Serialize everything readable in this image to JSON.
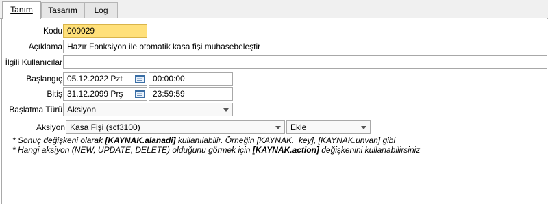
{
  "tabs": [
    {
      "label": "Tanım"
    },
    {
      "label": "Tasarım"
    },
    {
      "label": "Log"
    }
  ],
  "form": {
    "kodu_label": "Kodu",
    "kodu_value": "000029",
    "aciklama_label": "Açıklama",
    "aciklama_value": "Hazır Fonksiyon ile otomatik kasa fişi muhasebeleştir",
    "ilgili_label": "İlgili Kullanıcılar",
    "ilgili_value": "",
    "baslangic_label": "Başlangıç",
    "baslangic_date": "05.12.2022 Pzt",
    "baslangic_time": "00:00:00",
    "bitis_label": "Bitiş",
    "bitis_date": "31.12.2099 Prş",
    "bitis_time": "23:59:59",
    "baslatma_label": "Başlatma Türü",
    "baslatma_value": "Aksiyon",
    "aksiyon_label": "Aksiyon",
    "aksiyon_value": "Kasa Fişi (scf3100)",
    "aksiyon_op_value": "Ekle"
  },
  "notes": {
    "note1_pre": "* Sonuç değişkeni olarak ",
    "note1_bold": "[KAYNAK.alanadi]",
    "note1_post": " kullanılabilir. Örneğin [KAYNAK._key], [KAYNAK.unvan] gibi",
    "note2_pre": "* Hangi aksiyon (NEW, UPDATE, DELETE) olduğunu görmek için ",
    "note2_bold": "[KAYNAK.action]",
    "note2_post": " değişkenini kullanabilirsiniz"
  },
  "colors": {
    "highlight": "#ffe07a",
    "border": "#a8a8a8"
  }
}
